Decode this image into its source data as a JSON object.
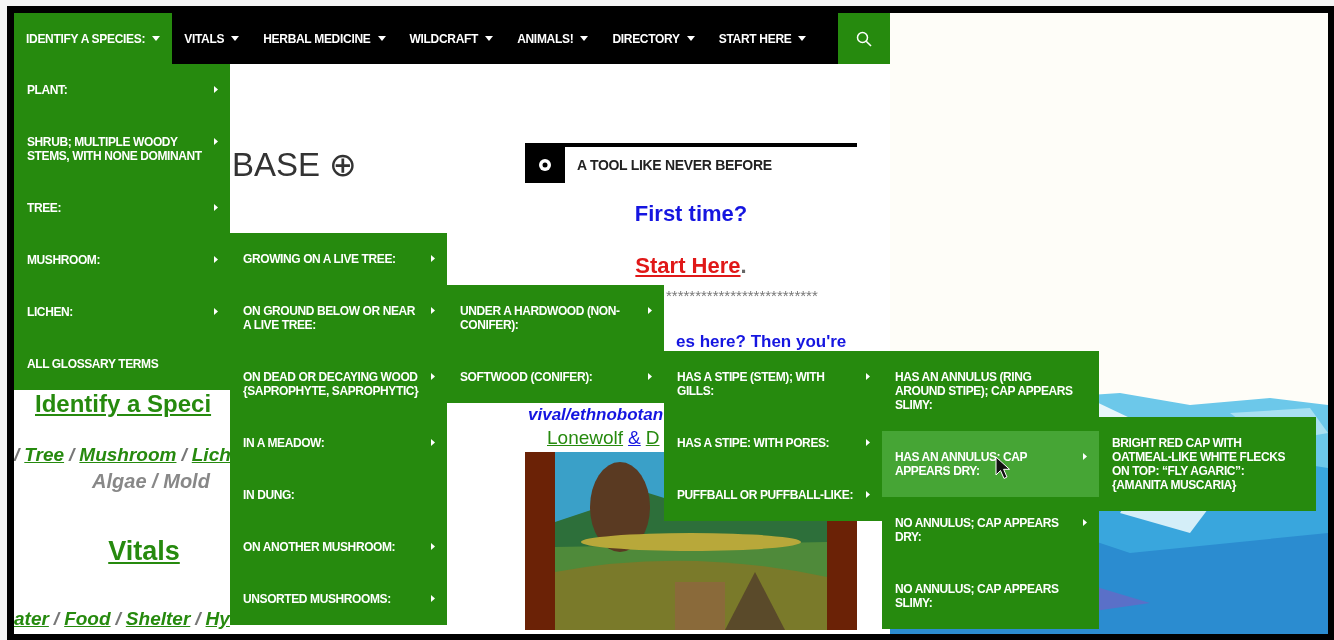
{
  "nav": {
    "items": [
      {
        "label": "IDENTIFY A SPECIES:",
        "selected": true
      },
      {
        "label": "VITALS",
        "selected": false
      },
      {
        "label": "HERBAL MEDICINE",
        "selected": false
      },
      {
        "label": "WILDCRAFT",
        "selected": false
      },
      {
        "label": "ANIMALS!",
        "selected": false
      },
      {
        "label": "DIRECTORY",
        "selected": false
      },
      {
        "label": "START HERE",
        "selected": false
      }
    ]
  },
  "left_column": {
    "heading": "BASE ⊕",
    "identify_link": "Identify a Speci",
    "category_links": [
      {
        "text": "/",
        "kind": "separator"
      },
      {
        "text": "Tree",
        "kind": "link"
      },
      {
        "text": "/",
        "kind": "separator"
      },
      {
        "text": "Mushroom",
        "kind": "link"
      },
      {
        "text": "/",
        "kind": "separator"
      },
      {
        "text": "Lich",
        "kind": "link"
      }
    ],
    "extra_categories": "Algae / Mold",
    "vitals_heading": "Vitals",
    "vitals_links": [
      {
        "text": "ater",
        "kind": "link"
      },
      {
        "text": "/",
        "kind": "separator"
      },
      {
        "text": "Food",
        "kind": "link"
      },
      {
        "text": "/",
        "kind": "separator"
      },
      {
        "text": "Shelter",
        "kind": "link"
      },
      {
        "text": "/",
        "kind": "separator"
      },
      {
        "text": "Hy",
        "kind": "link"
      }
    ]
  },
  "center_column": {
    "widget_title": "A TOOL LIKE NEVER BEFORE",
    "first_time": "First time?",
    "start_here": {
      "link": "Start Here",
      "suffix": "."
    },
    "divider": "**************************",
    "tagline": "es here? Then you're",
    "subtitle": "vival/ethnobotan",
    "credits": [
      {
        "text": "Lonewolf",
        "kind": "link"
      },
      {
        "text": "&",
        "kind": "link-blue"
      },
      {
        "text": "D",
        "kind": "link"
      }
    ]
  },
  "menus": [
    {
      "items": [
        {
          "label": "PLANT:",
          "has_submenu": true,
          "selected": false
        },
        {
          "label": "SHRUB; MULTIPLE WOODY STEMS, WITH NONE DOMINANT",
          "has_submenu": true,
          "selected": false
        },
        {
          "label": "TREE:",
          "has_submenu": true,
          "selected": false
        },
        {
          "label": "MUSHROOM:",
          "has_submenu": true,
          "selected": false
        },
        {
          "label": "LICHEN:",
          "has_submenu": true,
          "selected": false
        },
        {
          "label": "ALL GLOSSARY TERMS",
          "has_submenu": false,
          "selected": false
        }
      ]
    },
    {
      "items": [
        {
          "label": "GROWING ON A LIVE TREE:",
          "has_submenu": true,
          "selected": false
        },
        {
          "label": "ON GROUND BELOW OR NEAR A LIVE TREE:",
          "has_submenu": true,
          "selected": false
        },
        {
          "label": "ON DEAD OR DECAYING WOOD {SAPROPHYTE, SAPROPHYTIC}",
          "has_submenu": true,
          "selected": false
        },
        {
          "label": "IN A MEADOW:",
          "has_submenu": true,
          "selected": false
        },
        {
          "label": "IN DUNG:",
          "has_submenu": false,
          "selected": false
        },
        {
          "label": "ON ANOTHER MUSHROOM:",
          "has_submenu": true,
          "selected": false
        },
        {
          "label": "UNSORTED MUSHROOMS:",
          "has_submenu": true,
          "selected": false
        }
      ]
    },
    {
      "items": [
        {
          "label": "UNDER A HARDWOOD (NON-CONIFER):",
          "has_submenu": true,
          "selected": false
        },
        {
          "label": "SOFTWOOD (CONIFER):",
          "has_submenu": true,
          "selected": false
        }
      ]
    },
    {
      "items": [
        {
          "label": "HAS A STIPE (STEM); WITH GILLS:",
          "has_submenu": true,
          "selected": false
        },
        {
          "label": "HAS A STIPE: WITH PORES:",
          "has_submenu": true,
          "selected": false
        },
        {
          "label": "PUFFBALL OR PUFFBALL-LIKE:",
          "has_submenu": true,
          "selected": false
        }
      ]
    },
    {
      "items": [
        {
          "label": "HAS AN ANNULUS (RING AROUND STIPE); CAP APPEARS SLIMY:",
          "has_submenu": false,
          "selected": false
        },
        {
          "label": "HAS AN ANNULUS; CAP APPEARS DRY:",
          "has_submenu": true,
          "selected": true
        },
        {
          "label": "NO ANNULUS; CAP APPEARS DRY:",
          "has_submenu": true,
          "selected": false
        },
        {
          "label": "NO ANNULUS; CAP APPEARS SLIMY:",
          "has_submenu": false,
          "selected": false
        }
      ]
    },
    {
      "items": [
        {
          "label": "BRIGHT RED CAP WITH OATMEAL-LIKE WHITE FLECKS ON TOP: “FLY AGARIC”: {AMANITA MUSCARIA}",
          "has_submenu": false,
          "selected": false
        }
      ]
    }
  ]
}
